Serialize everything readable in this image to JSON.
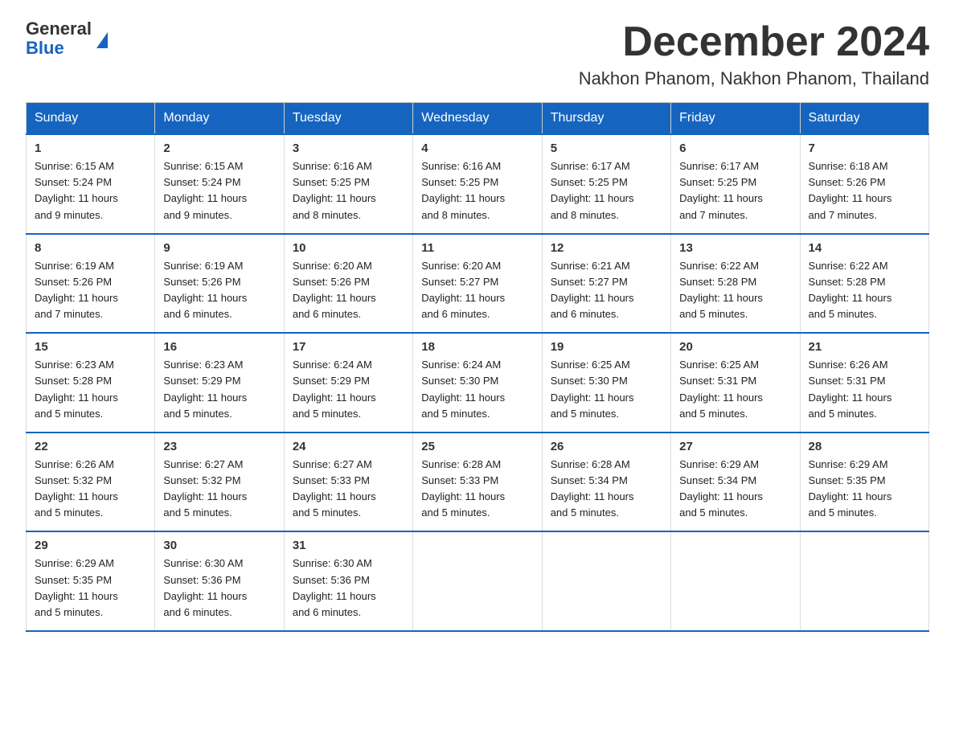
{
  "header": {
    "logo": {
      "general": "General",
      "blue": "Blue"
    },
    "title": "December 2024",
    "subtitle": "Nakhon Phanom, Nakhon Phanom, Thailand"
  },
  "days_of_week": [
    "Sunday",
    "Monday",
    "Tuesday",
    "Wednesday",
    "Thursday",
    "Friday",
    "Saturday"
  ],
  "weeks": [
    [
      {
        "day": "1",
        "sunrise": "6:15 AM",
        "sunset": "5:24 PM",
        "daylight": "11 hours and 9 minutes."
      },
      {
        "day": "2",
        "sunrise": "6:15 AM",
        "sunset": "5:24 PM",
        "daylight": "11 hours and 9 minutes."
      },
      {
        "day": "3",
        "sunrise": "6:16 AM",
        "sunset": "5:25 PM",
        "daylight": "11 hours and 8 minutes."
      },
      {
        "day": "4",
        "sunrise": "6:16 AM",
        "sunset": "5:25 PM",
        "daylight": "11 hours and 8 minutes."
      },
      {
        "day": "5",
        "sunrise": "6:17 AM",
        "sunset": "5:25 PM",
        "daylight": "11 hours and 8 minutes."
      },
      {
        "day": "6",
        "sunrise": "6:17 AM",
        "sunset": "5:25 PM",
        "daylight": "11 hours and 7 minutes."
      },
      {
        "day": "7",
        "sunrise": "6:18 AM",
        "sunset": "5:26 PM",
        "daylight": "11 hours and 7 minutes."
      }
    ],
    [
      {
        "day": "8",
        "sunrise": "6:19 AM",
        "sunset": "5:26 PM",
        "daylight": "11 hours and 7 minutes."
      },
      {
        "day": "9",
        "sunrise": "6:19 AM",
        "sunset": "5:26 PM",
        "daylight": "11 hours and 6 minutes."
      },
      {
        "day": "10",
        "sunrise": "6:20 AM",
        "sunset": "5:26 PM",
        "daylight": "11 hours and 6 minutes."
      },
      {
        "day": "11",
        "sunrise": "6:20 AM",
        "sunset": "5:27 PM",
        "daylight": "11 hours and 6 minutes."
      },
      {
        "day": "12",
        "sunrise": "6:21 AM",
        "sunset": "5:27 PM",
        "daylight": "11 hours and 6 minutes."
      },
      {
        "day": "13",
        "sunrise": "6:22 AM",
        "sunset": "5:28 PM",
        "daylight": "11 hours and 5 minutes."
      },
      {
        "day": "14",
        "sunrise": "6:22 AM",
        "sunset": "5:28 PM",
        "daylight": "11 hours and 5 minutes."
      }
    ],
    [
      {
        "day": "15",
        "sunrise": "6:23 AM",
        "sunset": "5:28 PM",
        "daylight": "11 hours and 5 minutes."
      },
      {
        "day": "16",
        "sunrise": "6:23 AM",
        "sunset": "5:29 PM",
        "daylight": "11 hours and 5 minutes."
      },
      {
        "day": "17",
        "sunrise": "6:24 AM",
        "sunset": "5:29 PM",
        "daylight": "11 hours and 5 minutes."
      },
      {
        "day": "18",
        "sunrise": "6:24 AM",
        "sunset": "5:30 PM",
        "daylight": "11 hours and 5 minutes."
      },
      {
        "day": "19",
        "sunrise": "6:25 AM",
        "sunset": "5:30 PM",
        "daylight": "11 hours and 5 minutes."
      },
      {
        "day": "20",
        "sunrise": "6:25 AM",
        "sunset": "5:31 PM",
        "daylight": "11 hours and 5 minutes."
      },
      {
        "day": "21",
        "sunrise": "6:26 AM",
        "sunset": "5:31 PM",
        "daylight": "11 hours and 5 minutes."
      }
    ],
    [
      {
        "day": "22",
        "sunrise": "6:26 AM",
        "sunset": "5:32 PM",
        "daylight": "11 hours and 5 minutes."
      },
      {
        "day": "23",
        "sunrise": "6:27 AM",
        "sunset": "5:32 PM",
        "daylight": "11 hours and 5 minutes."
      },
      {
        "day": "24",
        "sunrise": "6:27 AM",
        "sunset": "5:33 PM",
        "daylight": "11 hours and 5 minutes."
      },
      {
        "day": "25",
        "sunrise": "6:28 AM",
        "sunset": "5:33 PM",
        "daylight": "11 hours and 5 minutes."
      },
      {
        "day": "26",
        "sunrise": "6:28 AM",
        "sunset": "5:34 PM",
        "daylight": "11 hours and 5 minutes."
      },
      {
        "day": "27",
        "sunrise": "6:29 AM",
        "sunset": "5:34 PM",
        "daylight": "11 hours and 5 minutes."
      },
      {
        "day": "28",
        "sunrise": "6:29 AM",
        "sunset": "5:35 PM",
        "daylight": "11 hours and 5 minutes."
      }
    ],
    [
      {
        "day": "29",
        "sunrise": "6:29 AM",
        "sunset": "5:35 PM",
        "daylight": "11 hours and 5 minutes."
      },
      {
        "day": "30",
        "sunrise": "6:30 AM",
        "sunset": "5:36 PM",
        "daylight": "11 hours and 6 minutes."
      },
      {
        "day": "31",
        "sunrise": "6:30 AM",
        "sunset": "5:36 PM",
        "daylight": "11 hours and 6 minutes."
      },
      null,
      null,
      null,
      null
    ]
  ],
  "labels": {
    "sunrise": "Sunrise:",
    "sunset": "Sunset:",
    "daylight": "Daylight:"
  }
}
